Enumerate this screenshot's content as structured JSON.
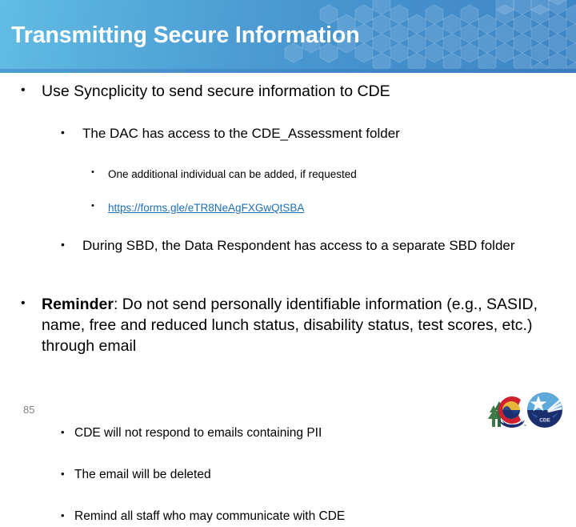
{
  "header": {
    "title": "Transmitting Secure Information",
    "gradient_start": "#62BCE4",
    "gradient_end": "#3E86C6",
    "rule_color": "#4189C9",
    "title_color": "#FFFFFF"
  },
  "bullets": {
    "b1": "Use Syncplicity to send secure information to CDE",
    "b2": "The DAC has access to the CDE_Assessment folder",
    "b3": "One additional individual can be added, if requested",
    "b4_link": "https://forms.gle/eTR8NeAgFXGwQtSBA",
    "b5": "During SBD, the Data Respondent has access to a separate SBD folder",
    "b6_lead": "Reminder",
    "b6_rest": ": Do not send personally identifiable information (e.g., SASID, name, free and reduced lunch status, disability status, test scores, etc.) through email",
    "b7": "CDE will not respond to emails containing PII",
    "b8": "The email will be deleted",
    "b9": "Remind all staff who may communicate with CDE"
  },
  "marker": {
    "glyph": "•"
  },
  "footer": {
    "page_number": "85",
    "logo_colorado_name": "colorado-state-logo",
    "logo_cde_name": "cde-logo",
    "logo_cde_text": "CDE",
    "page_number_color": "#808080",
    "link_color": "#1F6FB4"
  }
}
